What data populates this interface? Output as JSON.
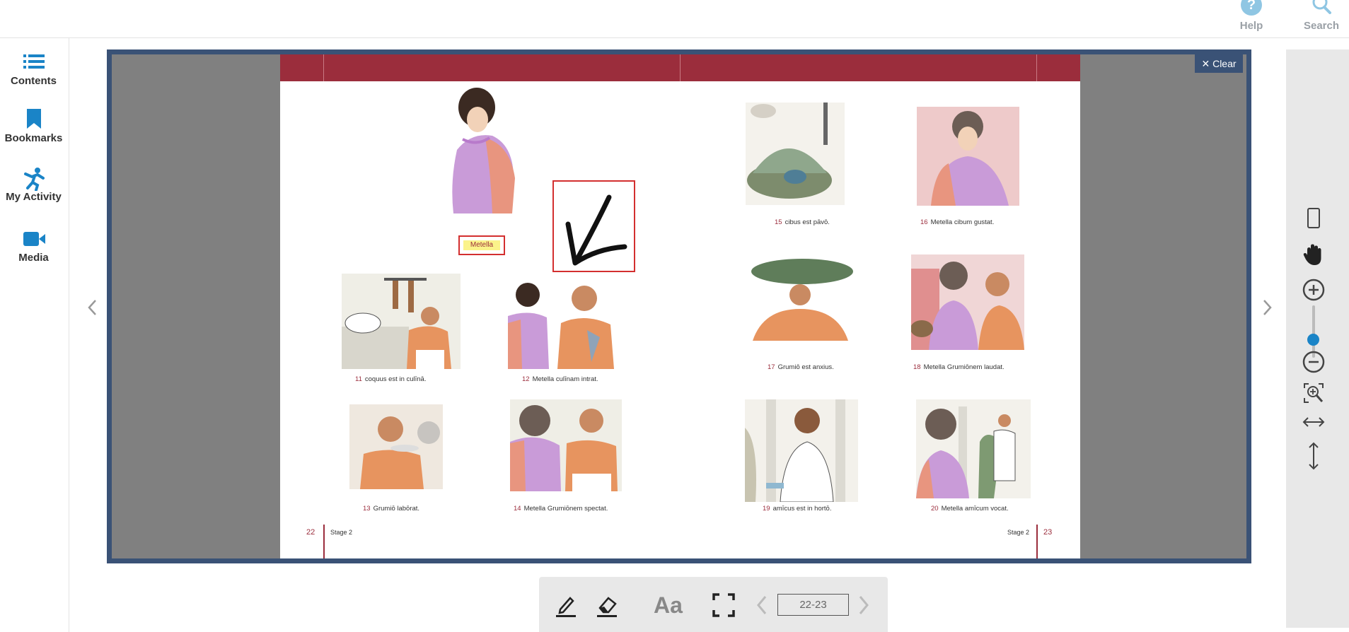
{
  "header": {
    "help_label": "Help",
    "search_label": "Search"
  },
  "sidebar": {
    "items": [
      {
        "label": "Contents",
        "icon": "list-icon"
      },
      {
        "label": "Bookmarks",
        "icon": "bookmark-icon"
      },
      {
        "label": "My Activity",
        "icon": "activity-icon"
      },
      {
        "label": "Media",
        "icon": "video-camera-icon"
      }
    ]
  },
  "viewer": {
    "clear_label": "Clear",
    "accent_color": "#9b2d3c",
    "frame_color": "#3a5276",
    "page_left": {
      "number": "22",
      "stage": "Stage 2",
      "hero_label": "Metella",
      "captions": [
        {
          "n": "11",
          "text": "coquus est in culīnā."
        },
        {
          "n": "12",
          "text": "Metella culīnam intrat."
        },
        {
          "n": "13",
          "text": "Grumiō labōrat."
        },
        {
          "n": "14",
          "text": "Metella Grumiōnem spectat."
        }
      ]
    },
    "page_right": {
      "number": "23",
      "stage": "Stage 2",
      "captions": [
        {
          "n": "15",
          "text": "cibus est pāvō."
        },
        {
          "n": "16",
          "text": "Metella cibum gustat."
        },
        {
          "n": "17",
          "text": "Grumiō est anxius."
        },
        {
          "n": "18",
          "text": "Metella Grumiōnem laudat."
        },
        {
          "n": "19",
          "text": "amīcus est in hortō."
        },
        {
          "n": "20",
          "text": "Metella amīcum vocat."
        }
      ]
    }
  },
  "right_tools": {
    "zoom_level_fraction": 0.55,
    "tools": [
      "single-page-icon",
      "pan-hand-icon",
      "zoom-in-icon",
      "zoom-out-icon",
      "zoom-region-icon",
      "fit-width-icon",
      "fit-height-icon"
    ]
  },
  "bottom_toolbar": {
    "text_tool_label": "Aa",
    "page_range": "22-23",
    "tools": [
      "pen-icon",
      "eraser-icon",
      "text-size-icon",
      "fullscreen-icon",
      "prev-page-icon",
      "next-page-icon"
    ]
  }
}
